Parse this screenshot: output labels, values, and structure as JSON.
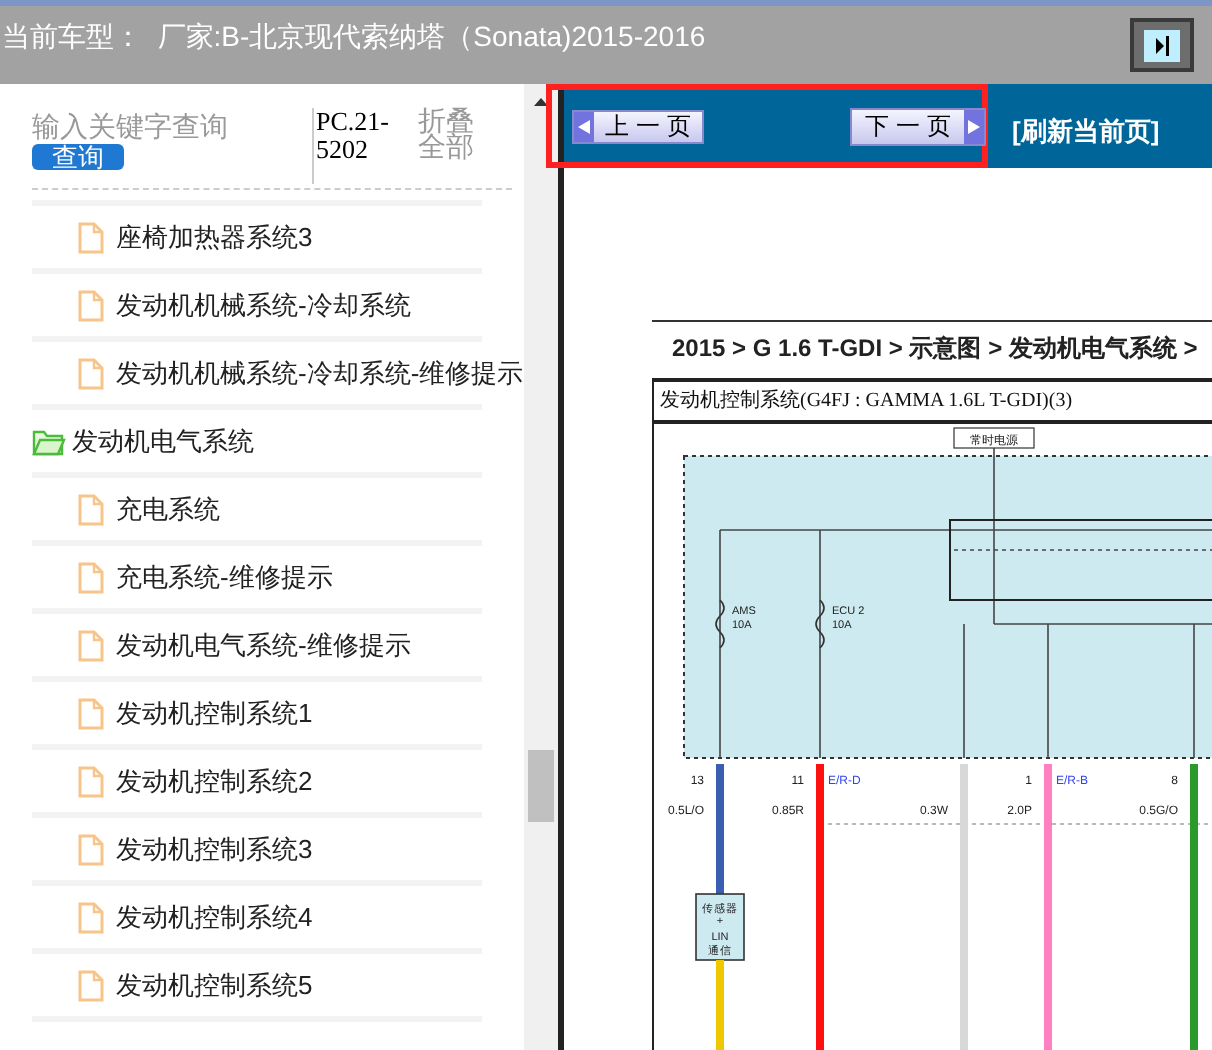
{
  "header": {
    "text": "当前车型：  厂家:B-北京现代索纳塔（Sonata)2015-2016"
  },
  "search": {
    "placeholder": "输入关键字查询",
    "button": "查询"
  },
  "code_label": "PC.21-5202",
  "collapse_all": "折叠全部",
  "tree": [
    {
      "kind": "file",
      "label": "座椅加热器系统3"
    },
    {
      "kind": "file",
      "label": "发动机机械系统-冷却系统"
    },
    {
      "kind": "file",
      "label": "发动机机械系统-冷却系统-维修提示"
    },
    {
      "kind": "folder",
      "label": "发动机电气系统",
      "expanded": true,
      "children": [
        {
          "kind": "file",
          "label": "充电系统"
        },
        {
          "kind": "file",
          "label": "充电系统-维修提示"
        },
        {
          "kind": "file",
          "label": "发动机电气系统-维修提示"
        },
        {
          "kind": "file",
          "label": "发动机控制系统1"
        },
        {
          "kind": "file",
          "label": "发动机控制系统2"
        },
        {
          "kind": "file",
          "label": "发动机控制系统3"
        },
        {
          "kind": "file",
          "label": "发动机控制系统4"
        },
        {
          "kind": "file",
          "label": "发动机控制系统5"
        }
      ]
    }
  ],
  "toolbar": {
    "prev": "上 一 页",
    "next": "下 一 页",
    "refresh": "[刷新当前页]"
  },
  "document": {
    "breadcrumb": "2015 > G 1.6 T-GDI > 示意图 > 发动机电气系统 >",
    "title": "发动机控制系统(G4FJ : GAMMA 1.6L T-GDI)(3)",
    "power_label": "常时电源",
    "fuses": [
      {
        "name": "AMS",
        "rating": "10A"
      },
      {
        "name": "ECU 2",
        "rating": "10A"
      }
    ],
    "wires": [
      {
        "pin": "13",
        "spec": "0.5L/O",
        "color": "#3a5fb0"
      },
      {
        "pin": "11",
        "spec": "0.85R",
        "color": "#ff1010",
        "connector": "E/R-D"
      },
      {
        "spec": "0.3W",
        "color": "#d8d8d8"
      },
      {
        "pin": "1",
        "spec": "2.0P",
        "color": "#ff80c0",
        "connector": "E/R-B"
      },
      {
        "pin": "8",
        "spec": "0.5G/O",
        "color": "#2a9a2a"
      }
    ],
    "sensor": {
      "line1": "传感器",
      "line2": "+",
      "line3": "LIN",
      "line4": "通信"
    }
  }
}
